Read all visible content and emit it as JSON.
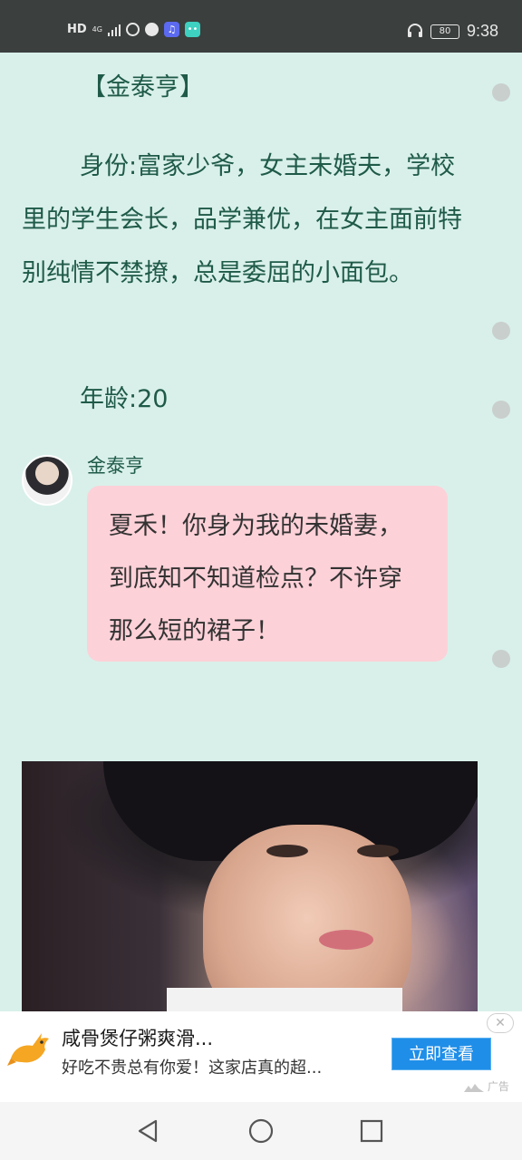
{
  "status_bar": {
    "hd": "HD",
    "network": "4G",
    "battery": "80",
    "time": "9:38",
    "icons": [
      "signal-icon",
      "hotspot-icon",
      "globe-icon",
      "music-app-icon",
      "robot-app-icon",
      "headphones-icon",
      "battery-icon"
    ]
  },
  "story": {
    "character_name": "【金泰亨】",
    "description": "身份:富家少爷，女主未婚夫，学校里的学生会长，品学兼优，在女主面前特别纯情不禁撩，总是委屈的小面包。",
    "age": "年龄:20"
  },
  "chat": {
    "speaker": "金泰亨",
    "message": "夏禾！你身为我的未婚妻，到底知不知道检点？不许穿那么短的裙子！"
  },
  "ad": {
    "title": "咸骨煲仔粥爽滑...",
    "subtitle": "好吃不贵总有你爱！这家店真的超...",
    "button": "立即查看",
    "close": "✕",
    "tag": "广告",
    "accent": "#1f8ee8"
  },
  "nav": {
    "icons": [
      "back-icon",
      "home-icon",
      "recents-icon"
    ]
  }
}
